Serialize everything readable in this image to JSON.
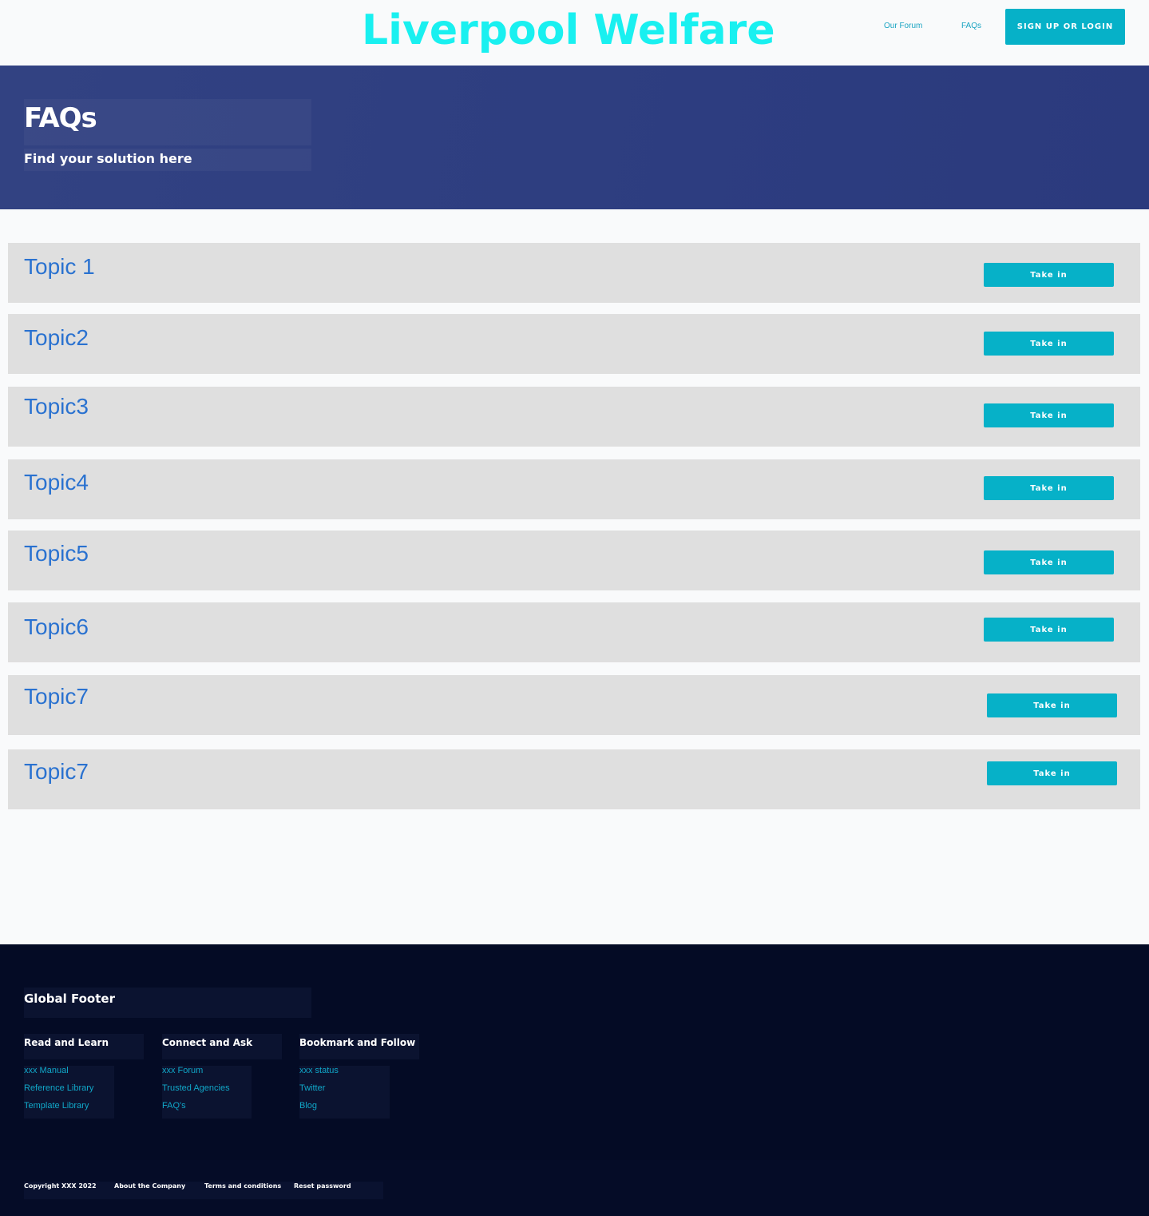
{
  "header": {
    "site_title": "Liverpool Welfare",
    "nav": {
      "forum": "Our Forum",
      "faqs": "FAQs"
    },
    "signup_label": "SIGN UP OR LOGIN"
  },
  "hero": {
    "title": "FAQs",
    "subtitle": "Find your solution here"
  },
  "topics": [
    {
      "title": "Topic 1",
      "button": "Take in"
    },
    {
      "title": "Topic2",
      "button": "Take in"
    },
    {
      "title": "Topic3",
      "button": "Take in"
    },
    {
      "title": "Topic4",
      "button": "Take in"
    },
    {
      "title": "Topic5",
      "button": "Take in"
    },
    {
      "title": "Topic6",
      "button": "Take in"
    },
    {
      "title": "Topic7",
      "button": "Take in"
    },
    {
      "title": "Topic7",
      "button": "Take in"
    }
  ],
  "footer": {
    "heading": "Global Footer",
    "columns": [
      {
        "title": "Read and Learn",
        "links": [
          "xxx Manual",
          "Reference Library",
          "Template Library"
        ]
      },
      {
        "title": "Connect and Ask",
        "links": [
          "xxx Forum",
          "Trusted Agencies",
          "FAQ's"
        ]
      },
      {
        "title": "Bookmark and Follow",
        "links": [
          "xxx status",
          "Twitter",
          "Blog"
        ]
      }
    ],
    "bottom": {
      "copyright": "Copyright XXX 2022",
      "about": "About the Company",
      "terms": "Terms and conditions",
      "reset": "Reset password"
    }
  },
  "colors": {
    "brand_title": "#19f0f0",
    "accent_button": "#06b1c8",
    "hero_background": "#2f3f80",
    "topic_text": "#2a72d0",
    "footer_background": "#040b25"
  }
}
